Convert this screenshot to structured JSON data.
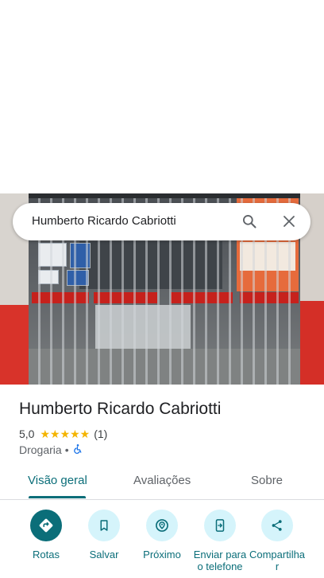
{
  "search": {
    "query": "Humberto Ricardo Cabriotti"
  },
  "place": {
    "name": "Humberto Ricardo Cabriotti",
    "rating": "5,0",
    "stars": "★★★★★",
    "review_count": "(1)",
    "category": "Drogaria",
    "separator": "•",
    "accessibility_icon": "wheelchair-icon"
  },
  "tabs": [
    {
      "label": "Visão geral",
      "active": true
    },
    {
      "label": "Avaliações",
      "active": false
    },
    {
      "label": "Sobre",
      "active": false
    }
  ],
  "actions": [
    {
      "label": "Rotas",
      "icon": "directions-icon"
    },
    {
      "label": "Salvar",
      "icon": "bookmark-icon"
    },
    {
      "label": "Próximo",
      "icon": "nearby-icon"
    },
    {
      "label": "Enviar para o telefone",
      "icon": "send-to-phone-icon"
    },
    {
      "label": "Compartilhar",
      "icon": "share-icon"
    }
  ],
  "colors": {
    "accent": "#0b6e79",
    "accent_light": "#d5f4fb",
    "star": "#f4b400"
  }
}
